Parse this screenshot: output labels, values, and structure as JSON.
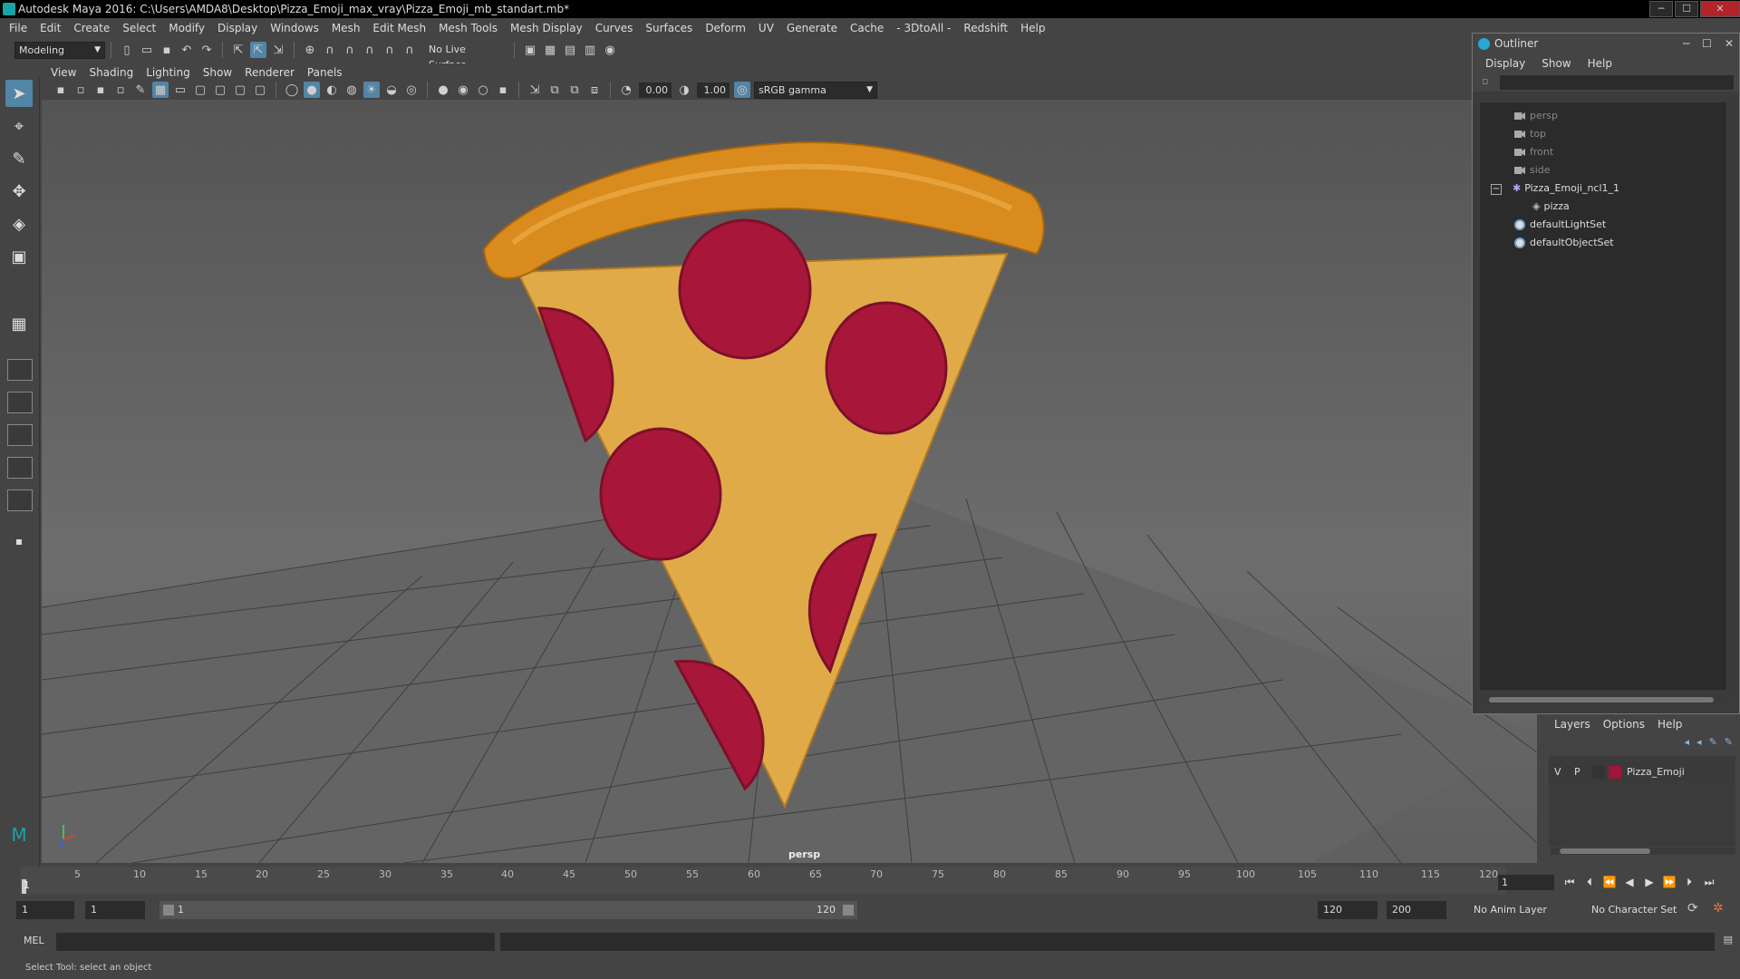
{
  "window": {
    "title": "Autodesk Maya 2016: C:\\Users\\AMDA8\\Desktop\\Pizza_Emoji_max_vray\\Pizza_Emoji_mb_standart.mb*"
  },
  "menubar": [
    "File",
    "Edit",
    "Create",
    "Select",
    "Modify",
    "Display",
    "Windows",
    "Mesh",
    "Edit Mesh",
    "Mesh Tools",
    "Mesh Display",
    "Curves",
    "Surfaces",
    "Deform",
    "UV",
    "Generate",
    "Cache",
    "- 3DtoAll -",
    "Redshift",
    "Help"
  ],
  "statusline": {
    "mode": "Modeling",
    "live_surface": "No Live Surface"
  },
  "panel": {
    "menu": [
      "View",
      "Shading",
      "Lighting",
      "Show",
      "Renderer",
      "Panels"
    ],
    "exposure": "0.00",
    "gamma": "1.00",
    "colorspace": "sRGB gamma",
    "camera_label": "persp"
  },
  "outliner": {
    "title": "Outliner",
    "menu": [
      "Display",
      "Show",
      "Help"
    ],
    "items": [
      {
        "label": "persp",
        "type": "camera"
      },
      {
        "label": "top",
        "type": "camera"
      },
      {
        "label": "front",
        "type": "camera"
      },
      {
        "label": "side",
        "type": "camera"
      },
      {
        "label": "Pizza_Emoji_ncl1_1",
        "type": "group"
      },
      {
        "label": "pizza",
        "type": "mesh"
      },
      {
        "label": "defaultLightSet",
        "type": "set"
      },
      {
        "label": "defaultObjectSet",
        "type": "set"
      }
    ]
  },
  "layer_editor": {
    "menu": [
      "Layers",
      "Options",
      "Help"
    ],
    "layer": {
      "v": "V",
      "p": "P",
      "name": "Pizza_Emoji",
      "color": "#a0153a"
    }
  },
  "timeline": {
    "labels": [
      "5",
      "10",
      "15",
      "20",
      "25",
      "30",
      "35",
      "40",
      "45",
      "50",
      "55",
      "60",
      "65",
      "70",
      "75",
      "80",
      "85",
      "90",
      "95",
      "100",
      "105",
      "110",
      "115",
      "120"
    ],
    "cursor_label": "1",
    "current_frame": "1"
  },
  "range": {
    "start": "1",
    "playback_start": "1",
    "slider_start": "1",
    "slider_end": "120",
    "playback_end": "120",
    "end": "200",
    "anim_layer": "No Anim Layer",
    "char_set": "No Character Set"
  },
  "cmdline": {
    "lang": "MEL"
  },
  "helpline": {
    "text": "Select Tool: select an object"
  },
  "colors": {
    "crust": "#d98b1e",
    "cheese": "#e0aa48",
    "pepperoni": "#a8173a",
    "accent": "#5285a6"
  }
}
